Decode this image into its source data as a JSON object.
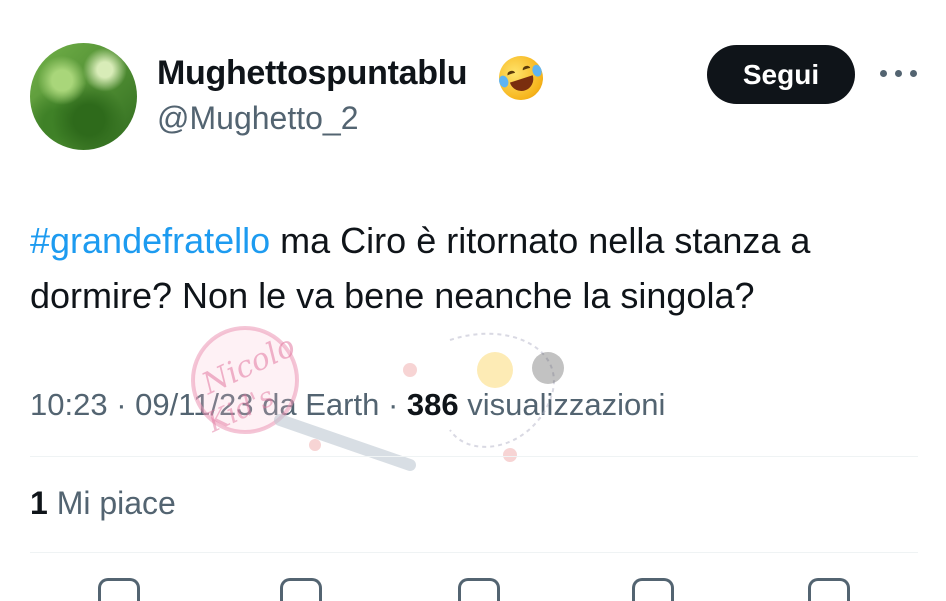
{
  "user": {
    "display_name": "Mughettospuntablu",
    "handle": "@Mughetto_2",
    "emoji": "rolling-on-floor-laughing"
  },
  "follow_button_label": "Segui",
  "tweet": {
    "hashtag": "#grandefratello",
    "text": " ma Ciro è ritornato nella stanza a dormire? Non le va bene neanche la singola?"
  },
  "meta": {
    "time": "10:23",
    "separator": " · ",
    "date": "09/11/23",
    "source_prefix": " da ",
    "source": "Earth",
    "views_count": "386",
    "views_label": " visualizzazioni"
  },
  "engagement": {
    "likes_count": "1",
    "likes_label": " Mi piace"
  },
  "watermark_text": "Nicolo Kid's",
  "colors": {
    "link": "#1d9bf0",
    "text": "#0f1419",
    "secondary": "#536471",
    "button": "#0f1419",
    "divider": "#eff3f4"
  },
  "icons": [
    "more-options-icon",
    "reply-icon",
    "retweet-icon",
    "like-icon",
    "bookmark-icon",
    "share-icon"
  ]
}
